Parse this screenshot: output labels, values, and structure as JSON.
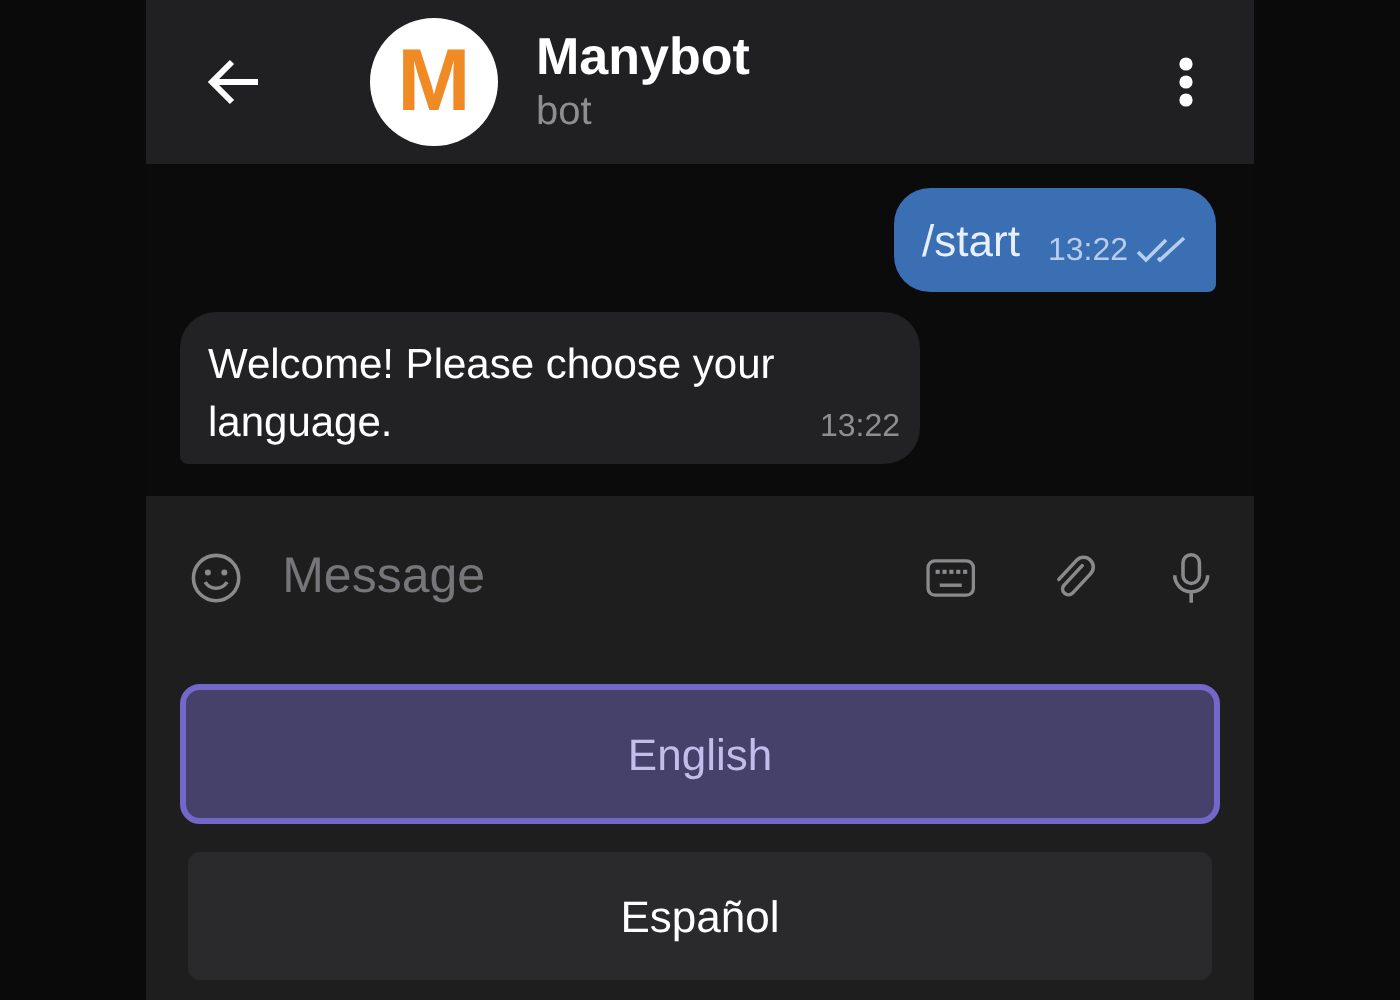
{
  "header": {
    "avatar_letter": "M",
    "title": "Manybot",
    "subtitle": "bot"
  },
  "messages": [
    {
      "kind": "outgoing",
      "text": "/start",
      "time": "13:22",
      "read": true
    },
    {
      "kind": "incoming",
      "text": "Welcome! Please choose your language.",
      "time": "13:22"
    }
  ],
  "composer": {
    "placeholder": "Message"
  },
  "keyboard_buttons": [
    {
      "label": "English",
      "selected": true
    },
    {
      "label": "Español",
      "selected": false
    }
  ]
}
